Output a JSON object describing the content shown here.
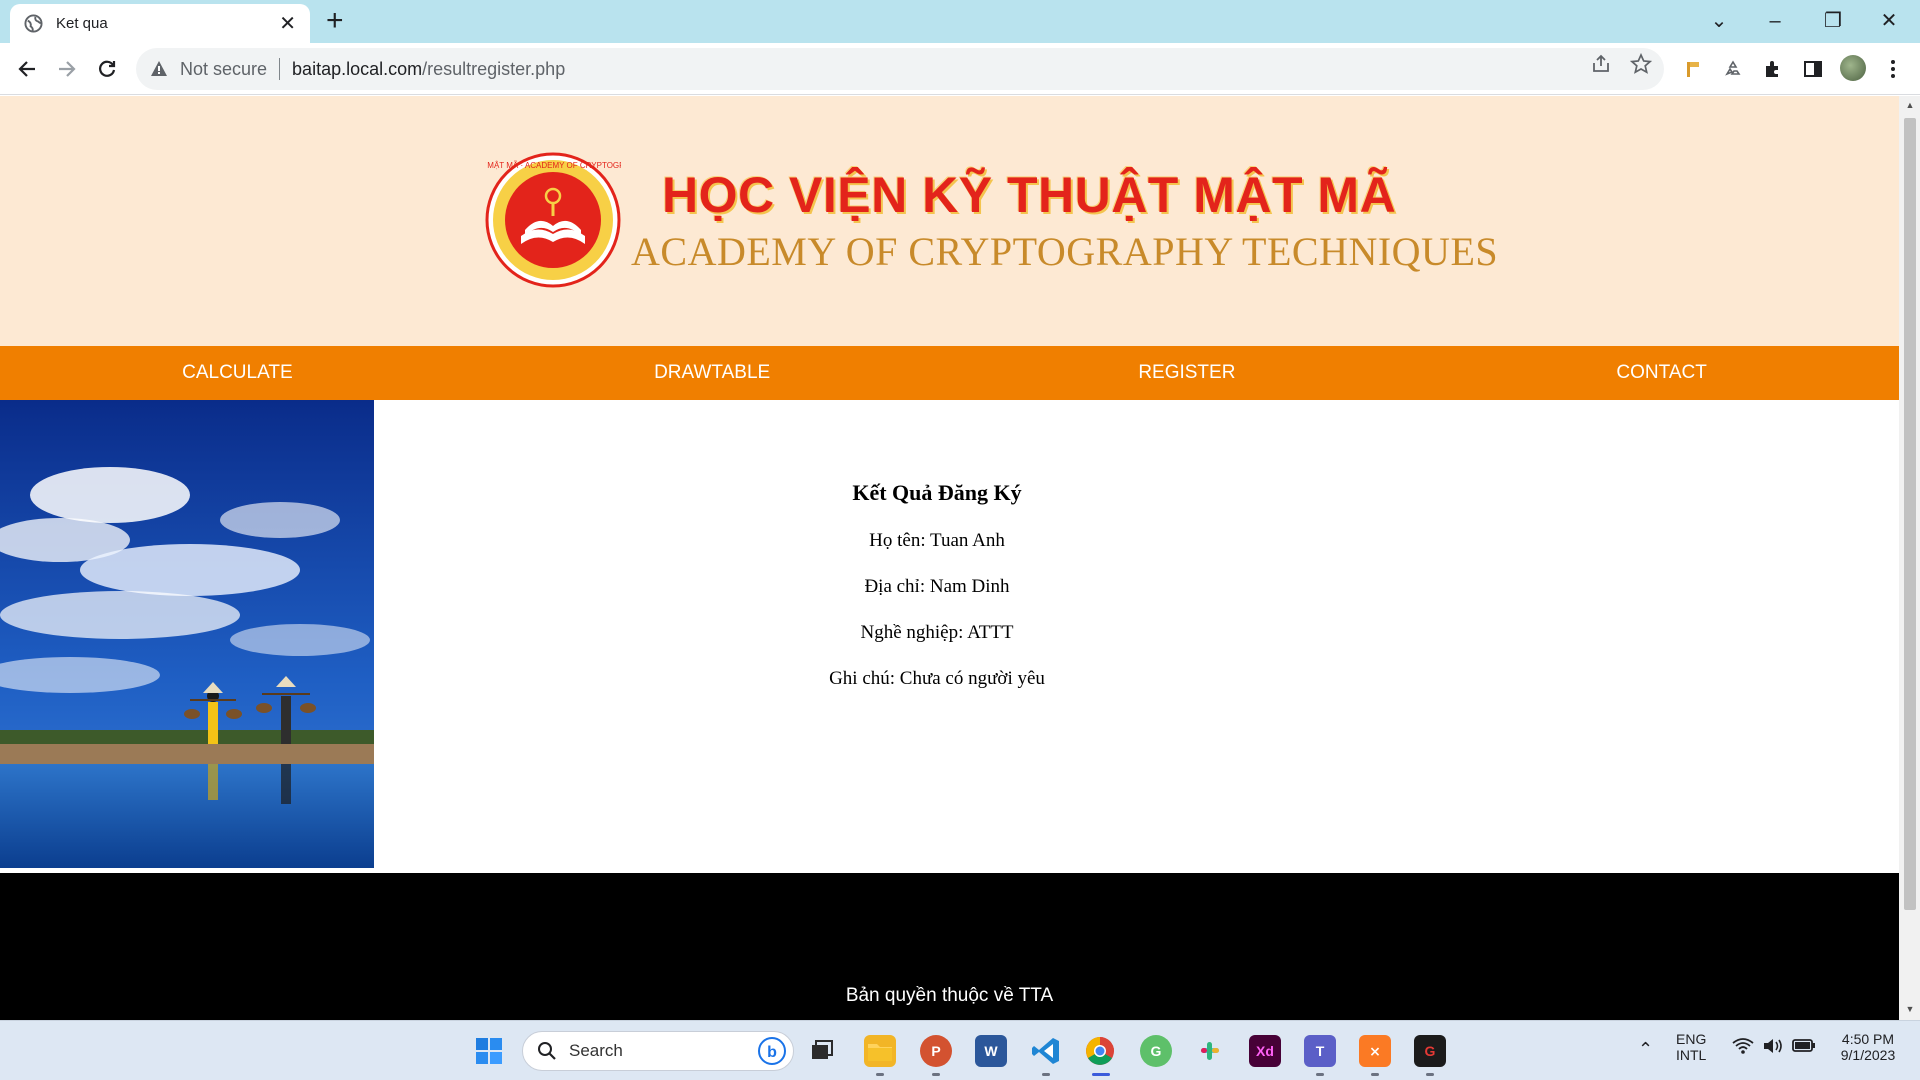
{
  "browser": {
    "tab_title": "Ket qua",
    "security_label": "Not secure",
    "url_host": "baitap.local.com",
    "url_path": "/resultregister.php"
  },
  "site": {
    "brand_vi": "HỌC VIỆN KỸ THUẬT MẬT MÃ",
    "brand_en": "ACADEMY OF CRYPTOGRAPHY TECHNIQUES",
    "logo_ring_text": "HỌC VIỆN KỸ THUẬT MẬT MÃ · ACADEMY OF CRYPTOGRAPHY TECHNIQUES",
    "menu": [
      {
        "label": "CALCULATE"
      },
      {
        "label": "DRAWTABLE"
      },
      {
        "label": "REGISTER"
      },
      {
        "label": "CONTACT"
      }
    ],
    "colors": {
      "hero_bg": "#fde9d3",
      "menu_bg": "#f07f00",
      "brand_red": "#e3241b",
      "brand_gold": "#c88a2a",
      "footer_bg": "#000000"
    }
  },
  "result": {
    "heading": "Kết Quả Đăng Ký",
    "name": "Họ tên: Tuan Anh",
    "address": "Địa chỉ: Nam Dinh",
    "job": "Nghề nghiệp: ATTT",
    "note": "Ghi chú: Chưa có người yêu"
  },
  "footer": {
    "copyright": "Bản quyền thuộc về TTA"
  },
  "taskbar": {
    "search_label": "Search",
    "lang_top": "ENG",
    "lang_bottom": "INTL",
    "time": "4:50 PM",
    "date": "9/1/2023",
    "apps": [
      "start-icon",
      "file-explorer-icon",
      "powerpoint-icon",
      "word-icon",
      "vscode-icon",
      "chrome-icon",
      "green-app-icon",
      "slack-icon",
      "adobe-xd-icon",
      "teams-icon",
      "xampp-icon",
      "red-app-icon"
    ]
  }
}
